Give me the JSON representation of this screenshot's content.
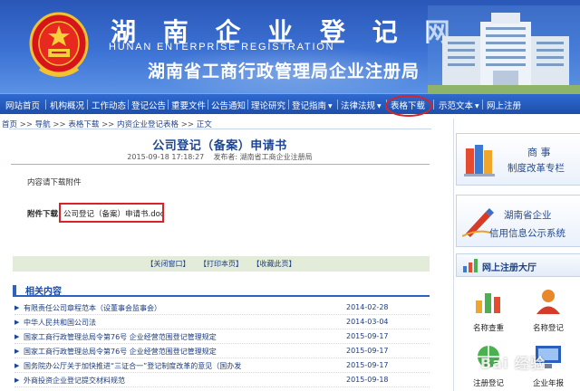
{
  "banner": {
    "title": "湖 南 企 业 登 记 网",
    "subtitle": "HUNAN ENTERPRISE REGISTRATION",
    "agency": "湖南省工商行政管理局企业注册局"
  },
  "nav": {
    "items": [
      {
        "label": "网站首页",
        "dropdown": false
      },
      {
        "label": "机构概况",
        "dropdown": false
      },
      {
        "label": "工作动态",
        "dropdown": false
      },
      {
        "label": "登记公告",
        "dropdown": false
      },
      {
        "label": "重要文件",
        "dropdown": false
      },
      {
        "label": "公告通知",
        "dropdown": false
      },
      {
        "label": "理论研究",
        "dropdown": false
      },
      {
        "label": "登记指南",
        "dropdown": true
      },
      {
        "label": "法律法规",
        "dropdown": true
      },
      {
        "label": "表格下载",
        "dropdown": false
      },
      {
        "label": "示范文本",
        "dropdown": true
      },
      {
        "label": "网上注册",
        "dropdown": false
      }
    ],
    "highlighted": "表格下载",
    "highlight_color": "#d9232b"
  },
  "breadcrumb": [
    "首页",
    "导航",
    "表格下载",
    "内资企业登记表格",
    "正文"
  ],
  "breadcrumb_separator": ">>",
  "article": {
    "title": "公司登记（备案）申请书",
    "datetime": "2015-09-18 17:18:27",
    "publisher": "发布者: 湖南省工商企业注册局",
    "intro": "内容请下载附件",
    "attachment_label": "附件下载:",
    "attachment_file": "公司登记（备案）申请书.doc"
  },
  "actions": [
    "【关闭窗口】",
    "【打印本页】",
    "【收藏此页】"
  ],
  "related": {
    "heading": "相关内容",
    "items": [
      {
        "text": "有限责任公司章程范本（设董事会监事会）",
        "date": "2014-02-28"
      },
      {
        "text": "中华人民共和国公司法",
        "date": "2014-03-04"
      },
      {
        "text": "国家工商行政管理总局令第76号 企业经营范围登记管理规定",
        "date": "2015-09-17"
      },
      {
        "text": "国家工商行政管理总局令第76号 企业经营范围登记管理规定",
        "date": "2015-09-17"
      },
      {
        "text": "国务院办公厅关于加快推进“三证合一”登记制度改革的意见（国办发",
        "date": "2015-09-17"
      },
      {
        "text": "外商投资企业登记提交材料规范",
        "date": "2015-09-18"
      }
    ]
  },
  "sidebar": {
    "promo1": {
      "line1": "商 事",
      "line2": "制度改革专栏"
    },
    "promo2": {
      "line1": "湖南省企业",
      "line2": "信用信息公示系统"
    },
    "hall": "网上注册大厅",
    "tiles": [
      "名称查重",
      "名称登记",
      "注册登记",
      "企业年报"
    ]
  },
  "watermark": "Bai 经验"
}
